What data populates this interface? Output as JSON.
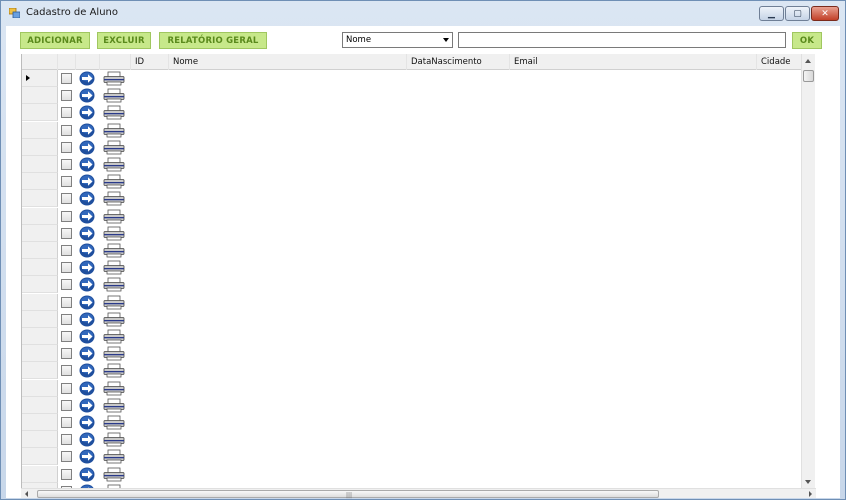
{
  "window": {
    "title": "Cadastro de Aluno",
    "minimize_glyph": "▁",
    "maximize_glyph": "▢",
    "close_glyph": "✕"
  },
  "toolbar": {
    "add_label": "ADICIONAR",
    "delete_label": "EXCLUIR",
    "report_label": "RELATÓRIO GERAL",
    "filter_selected": "Nome",
    "search_value": "",
    "ok_label": "OK",
    "button_color": "#c7e88a",
    "button_text_color": "#5a8a1c"
  },
  "grid": {
    "columns": [
      "ID",
      "Nome",
      "DataNascimento",
      "Email",
      "Cidade"
    ],
    "visible_rows": 25,
    "current_row": 0,
    "row_action_icons": [
      "arrow-right-circle-icon",
      "printer-icon"
    ]
  },
  "hscroll": {
    "grip": "|||"
  }
}
